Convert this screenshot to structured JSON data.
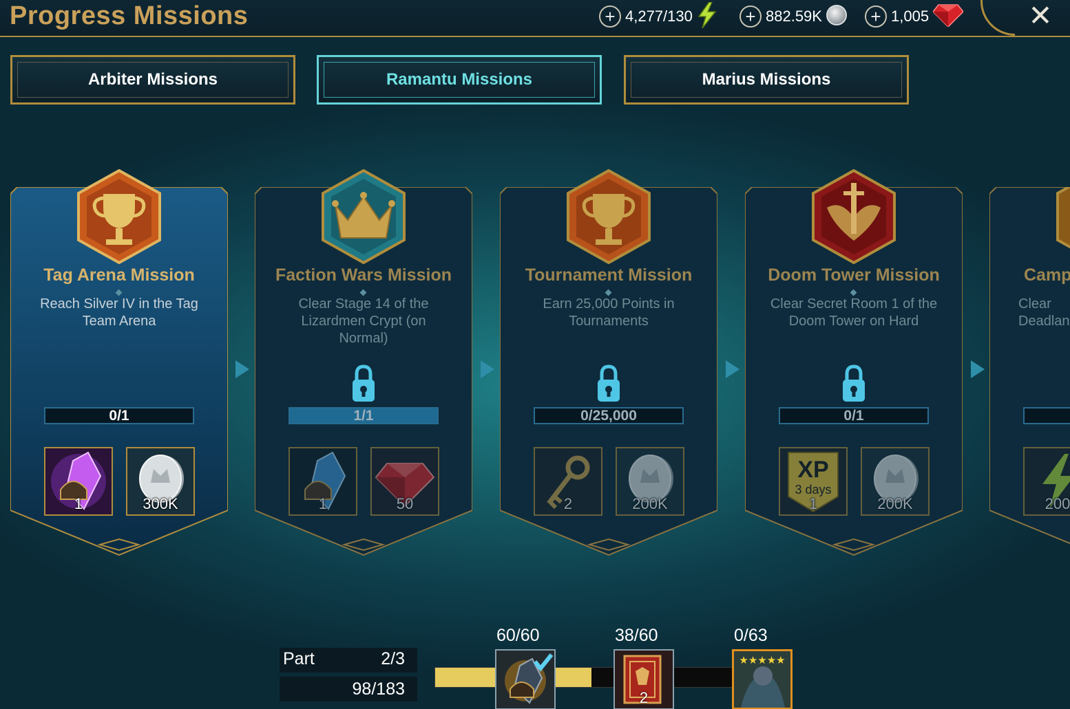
{
  "header": {
    "title": "Progress Missions",
    "close_icon": "close-icon"
  },
  "resources": {
    "energy": {
      "value": "4,277/130",
      "icon": "lightning-icon"
    },
    "silver": {
      "value": "882.59K",
      "icon": "silver-coin-icon"
    },
    "gems": {
      "value": "1,005",
      "icon": "ruby-icon"
    }
  },
  "tabs": [
    {
      "label": "Arbiter Missions",
      "active": false
    },
    {
      "label": "Ramantu Missions",
      "active": true
    },
    {
      "label": "Marius Missions",
      "active": false
    }
  ],
  "missions": [
    {
      "title": "Tag Arena Mission",
      "description": "Reach Silver IV in the Tag Team Arena",
      "progress": "0/1",
      "progress_fraction": 0,
      "locked": false,
      "rewards": [
        {
          "icon": "purple-shard-icon",
          "value": "1"
        },
        {
          "icon": "silver-coin-icon",
          "value": "300K"
        }
      ]
    },
    {
      "title": "Faction Wars Mission",
      "description": "Clear Stage 14 of the Lizardmen Crypt (on Normal)",
      "progress": "1/1",
      "progress_fraction": 1,
      "locked": true,
      "rewards": [
        {
          "icon": "blue-shard-icon",
          "value": "1"
        },
        {
          "icon": "ruby-icon",
          "value": "50"
        }
      ]
    },
    {
      "title": "Tournament Mission",
      "description": "Earn 25,000 Points in Tournaments",
      "progress": "0/25,000",
      "progress_fraction": 0,
      "locked": true,
      "rewards": [
        {
          "icon": "key-icon",
          "value": "2"
        },
        {
          "icon": "silver-coin-icon",
          "value": "200K"
        }
      ]
    },
    {
      "title": "Doom Tower Mission",
      "description": "Clear Secret Room 1 of the Doom Tower on Hard",
      "progress": "0/1",
      "progress_fraction": 0,
      "locked": true,
      "rewards": [
        {
          "icon": "xp-boost-icon",
          "value": "1",
          "badge_main": "XP",
          "badge_sub": "3 days"
        },
        {
          "icon": "silver-coin-icon",
          "value": "200K"
        }
      ]
    },
    {
      "title": "Camp",
      "description": "Clear\nDeadlan",
      "progress": "",
      "progress_fraction": 0,
      "locked": true,
      "rewards": [
        {
          "icon": "lightning-icon",
          "value": "200"
        }
      ]
    }
  ],
  "footer": {
    "part_label": "Part",
    "part_value": "2/3",
    "points": "98/183",
    "track_fraction": 0.526,
    "milestones": [
      {
        "label": "60/60",
        "icon": "shard-checked-icon",
        "value": "",
        "claimed": true
      },
      {
        "label": "38/60",
        "icon": "tome-icon",
        "value": "2",
        "claimed": false
      },
      {
        "label": "0/63",
        "icon": "champion-portrait-icon",
        "value": "",
        "claimed": false
      }
    ]
  },
  "colors": {
    "gold": "#b08d3c",
    "accent_teal": "#64d4d8",
    "lock_blue": "#4fc6e6",
    "bar_blue": "#1e6a93",
    "track_yellow": "#e6cc5f"
  }
}
